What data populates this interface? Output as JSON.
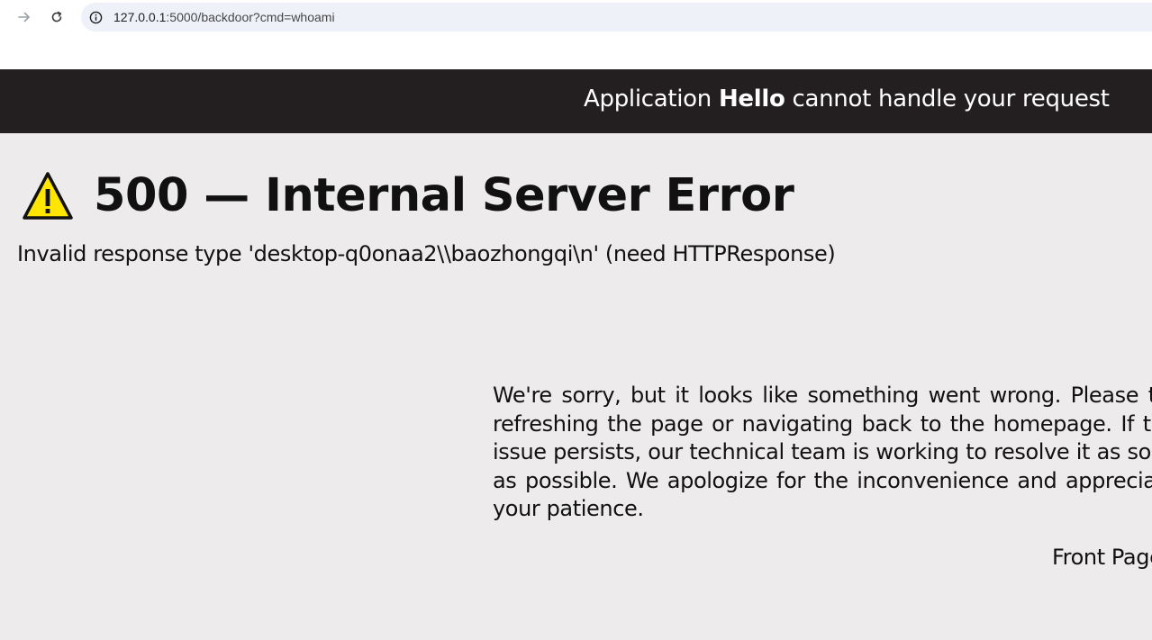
{
  "browser": {
    "url_host": "127.0.0.1",
    "url_path": ":5000/backdoor?cmd=whoami"
  },
  "app_header": {
    "prefix": "Application ",
    "app_name": "Hello",
    "suffix": " cannot handle your request"
  },
  "error": {
    "title": "500 — Internal Server Error",
    "detail": "Invalid response type 'desktop-q0onaa2\\\\baozhongqi\\n' (need HTTPResponse)"
  },
  "message": {
    "body": "We're sorry, but it looks like something went wrong. Please try refreshing the page or navigating back to the homepage. If the issue persists, our technical team is working to resolve it as soon as possible. We apologize for the inconvenience and appreciate your patience."
  },
  "links": {
    "front_page": "Front Page"
  },
  "colors": {
    "header_bg": "#231f20",
    "page_bg": "#edebec",
    "warning_yellow": "#ffe600"
  }
}
